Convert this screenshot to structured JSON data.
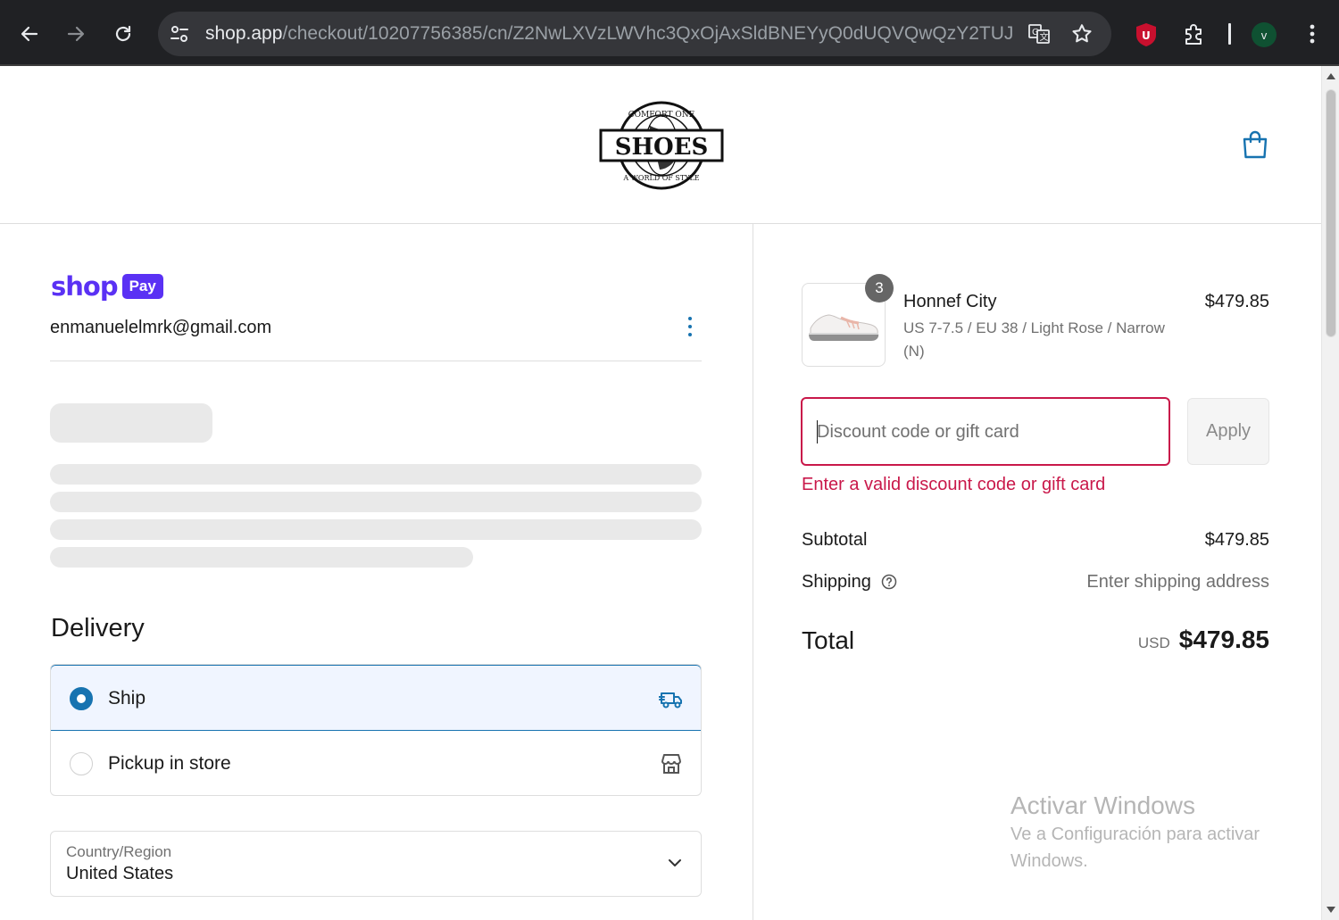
{
  "browser": {
    "url_host": "shop.app",
    "url_path": "/checkout/10207756385/cn/Z2NwLXVzLWVhc3QxOjAxSldBNEYyQ0dUQVQwQzY2TUJNU...",
    "profile_initial": "v",
    "icons": [
      "back-icon",
      "forward-icon",
      "reload-icon",
      "site-settings-icon",
      "translate-icon",
      "bookmark-star-icon",
      "ublock-shield-icon",
      "extensions-puzzle-icon",
      "chrome-menu-icon"
    ]
  },
  "header": {
    "logo_alt": "Comfort One Shoes - A World of Style",
    "logo_text_top": "COMFORT ONE",
    "logo_text_main": "SHOES",
    "logo_text_bottom": "A WORLD OF STYLE"
  },
  "account": {
    "shop_word": "shop",
    "pay_badge": "Pay",
    "email": "enmanuelelmrk@gmail.com"
  },
  "delivery": {
    "heading": "Delivery",
    "options": [
      {
        "label": "Ship",
        "selected": true
      },
      {
        "label": "Pickup in store",
        "selected": false
      }
    ],
    "country_label": "Country/Region",
    "country_value": "United States"
  },
  "order": {
    "item": {
      "quantity": "3",
      "name": "Honnef City",
      "variant": "US 7-7.5 / EU 38 / Light Rose / Narrow (N)",
      "price": "$479.85"
    },
    "discount": {
      "placeholder": "Discount code or gift card",
      "apply_label": "Apply",
      "error": "Enter a valid discount code or gift card"
    },
    "subtotal_label": "Subtotal",
    "subtotal_value": "$479.85",
    "shipping_label": "Shipping",
    "shipping_value": "Enter shipping address",
    "total_label": "Total",
    "total_currency": "USD",
    "total_value": "$479.85"
  },
  "watermark": {
    "line1": "Activar Windows",
    "line2": "Ve a Configuración para activar Windows."
  },
  "colors": {
    "accent": "#1773b0",
    "shop_purple": "#5a31f4",
    "error": "#c9184a"
  }
}
